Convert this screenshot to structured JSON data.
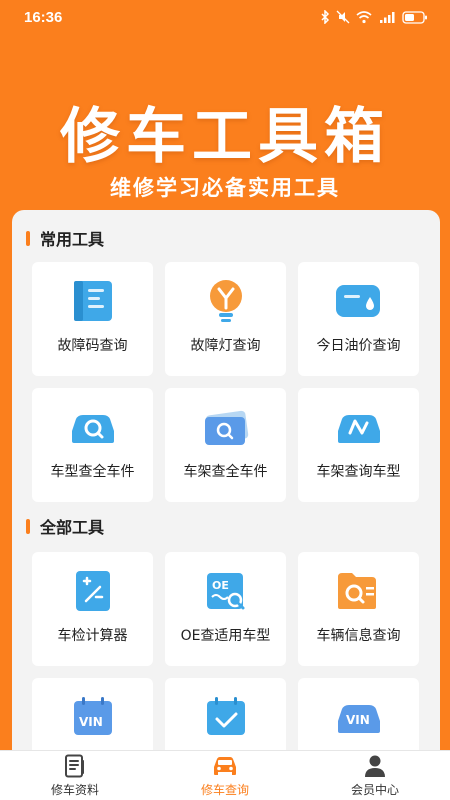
{
  "status_bar": {
    "time": "16:36",
    "battery": "battery-icon",
    "icons": [
      "bluetooth-icon",
      "mute-icon",
      "wifi-icon",
      "signal-icon",
      "battery-icon"
    ]
  },
  "hero": {
    "title": "修车工具箱",
    "subtitle": "维修学习必备实用工具"
  },
  "sections": [
    {
      "title": "常用工具",
      "items": [
        {
          "label": "故障码查询",
          "icon": "manual-book-icon"
        },
        {
          "label": "故障灯查询",
          "icon": "warning-bulb-icon"
        },
        {
          "label": "今日油价查询",
          "icon": "fuel-card-icon"
        },
        {
          "label": "车型查全车件",
          "icon": "car-search-icon"
        },
        {
          "label": "车架查全车件",
          "icon": "card-search-icon"
        },
        {
          "label": "车架查询车型",
          "icon": "car-frame-icon"
        }
      ]
    },
    {
      "title": "全部工具",
      "items": [
        {
          "label": "车检计算器",
          "icon": "calculator-icon"
        },
        {
          "label": "OE查适用车型",
          "icon": "oe-search-icon"
        },
        {
          "label": "车辆信息查询",
          "icon": "folder-search-icon"
        },
        {
          "label": "",
          "icon": "vin-calendar-icon"
        },
        {
          "label": "",
          "icon": "calendar-check-icon"
        },
        {
          "label": "",
          "icon": "vin-car-icon"
        }
      ]
    }
  ],
  "bottom_nav": [
    {
      "label": "修车资料",
      "icon": "document-icon",
      "active": false
    },
    {
      "label": "修车查询",
      "icon": "car-icon",
      "active": true
    },
    {
      "label": "会员中心",
      "icon": "user-icon",
      "active": false
    }
  ],
  "colors": {
    "accent": "#fb7f1d",
    "icon_blue": "#3fa8e8"
  }
}
